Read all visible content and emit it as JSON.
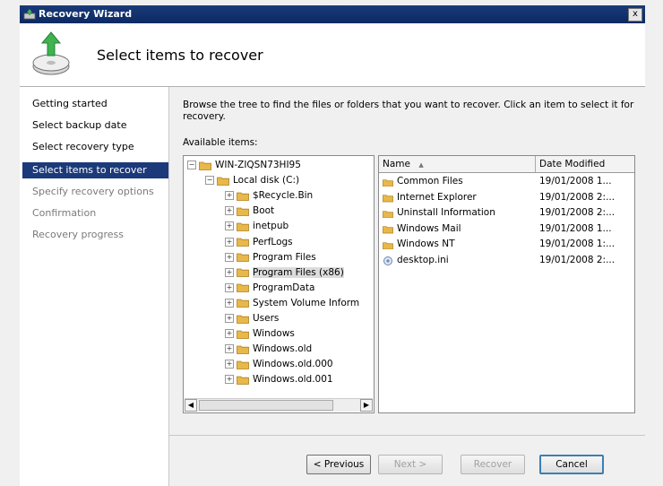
{
  "window": {
    "title": "Recovery Wizard",
    "close_label": "x"
  },
  "header": {
    "title": "Select items to recover",
    "icon": "backup-restore-icon"
  },
  "steps": [
    {
      "label": "Getting started",
      "state": "done"
    },
    {
      "label": "Select backup date",
      "state": "done"
    },
    {
      "label": "Select recovery type",
      "state": "done"
    },
    {
      "label": "Select items to recover",
      "state": "active"
    },
    {
      "label": "Specify recovery options",
      "state": "pending"
    },
    {
      "label": "Confirmation",
      "state": "pending"
    },
    {
      "label": "Recovery progress",
      "state": "pending"
    }
  ],
  "main": {
    "description": "Browse the tree to find the files or folders that you want to recover. Click an item to select it for recovery.",
    "available_label": "Available items:"
  },
  "tree": {
    "items": [
      {
        "label": "WIN-ZIQSN73HI95",
        "level": 0,
        "expander": "−"
      },
      {
        "label": "Local disk (C:)",
        "level": 1,
        "expander": "−"
      },
      {
        "label": "$Recycle.Bin",
        "level": 2,
        "expander": "+"
      },
      {
        "label": "Boot",
        "level": 2,
        "expander": "+"
      },
      {
        "label": "inetpub",
        "level": 2,
        "expander": "+"
      },
      {
        "label": "PerfLogs",
        "level": 2,
        "expander": "+"
      },
      {
        "label": "Program Files",
        "level": 2,
        "expander": "+"
      },
      {
        "label": "Program Files (x86)",
        "level": 2,
        "expander": "+",
        "selected": true
      },
      {
        "label": "ProgramData",
        "level": 2,
        "expander": "+"
      },
      {
        "label": "System Volume Inform",
        "level": 2,
        "expander": "+"
      },
      {
        "label": "Users",
        "level": 2,
        "expander": "+"
      },
      {
        "label": "Windows",
        "level": 2,
        "expander": "+"
      },
      {
        "label": "Windows.old",
        "level": 2,
        "expander": "+"
      },
      {
        "label": "Windows.old.000",
        "level": 2,
        "expander": "+"
      },
      {
        "label": "Windows.old.001",
        "level": 2,
        "expander": "+"
      }
    ],
    "scroll_left": "◀",
    "scroll_right": "▶"
  },
  "files": {
    "columns": {
      "name": "Name",
      "sort_indicator": "▲",
      "date": "Date Modified"
    },
    "rows": [
      {
        "name": "Common Files",
        "date": "19/01/2008 1...",
        "type": "folder"
      },
      {
        "name": "Internet Explorer",
        "date": "19/01/2008 2:...",
        "type": "folder"
      },
      {
        "name": "Uninstall Information",
        "date": "19/01/2008 2:...",
        "type": "folder"
      },
      {
        "name": "Windows Mail",
        "date": "19/01/2008 1...",
        "type": "folder"
      },
      {
        "name": "Windows NT",
        "date": "19/01/2008 1:...",
        "type": "folder"
      },
      {
        "name": "desktop.ini",
        "date": "19/01/2008 2:...",
        "type": "settings-file"
      }
    ]
  },
  "buttons": {
    "previous": "< Previous",
    "next": "Next >",
    "recover": "Recover",
    "cancel": "Cancel"
  },
  "colors": {
    "titlebar": "#0b2a63",
    "active_step": "#1c3a7a",
    "folder": "#e8b84a"
  }
}
